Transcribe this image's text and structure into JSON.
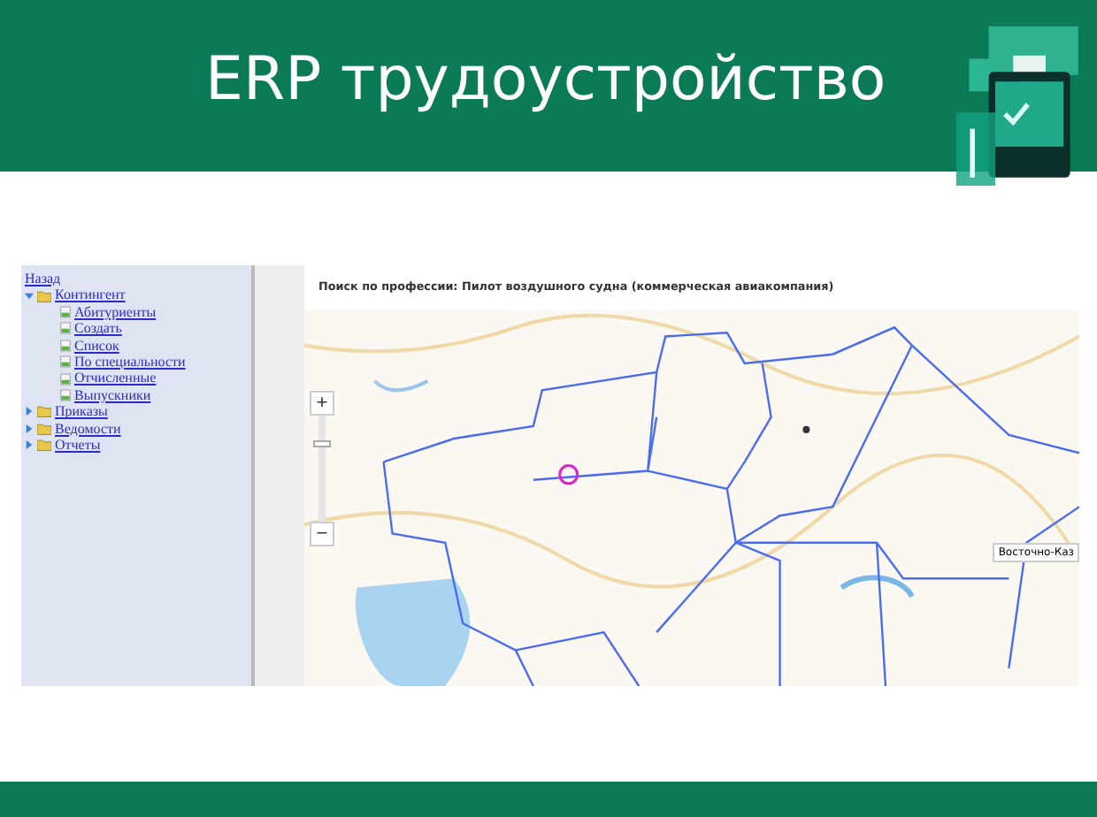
{
  "slide": {
    "title": "ERP трудоустройство"
  },
  "sidebar": {
    "back_link": "Назад",
    "tree": [
      {
        "label": "Контингент",
        "expanded": true,
        "children": [
          {
            "label": "Абитуриенты"
          },
          {
            "label": "Создать"
          },
          {
            "label": "Список"
          },
          {
            "label": "По специальности"
          },
          {
            "label": "Отчисленные"
          },
          {
            "label": "Выпускники"
          }
        ]
      },
      {
        "label": "Приказы",
        "expanded": false
      },
      {
        "label": "Ведомости",
        "expanded": false
      },
      {
        "label": "Отчеты",
        "expanded": false
      }
    ]
  },
  "content": {
    "heading": "Поиск по профессии: Пилот воздушного судна (коммерческая авиакомпания)",
    "map": {
      "zoom_in": "+",
      "zoom_out": "−",
      "zoom_slider": {
        "level": 0.75
      },
      "tooltip": "Восточно-Каз"
    }
  }
}
